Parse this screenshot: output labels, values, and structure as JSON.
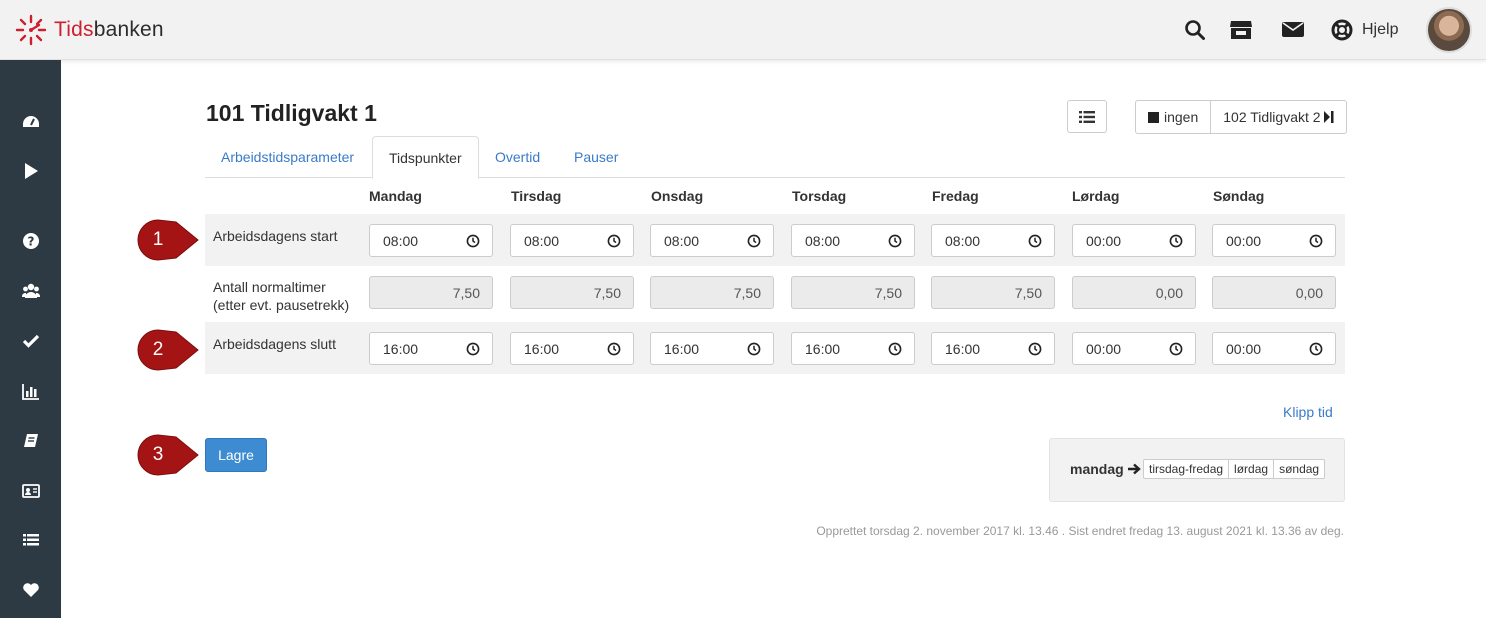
{
  "header": {
    "logo_text_accent": "Tids",
    "logo_text_rest": "banken",
    "help_label": "Hjelp",
    "icons": [
      "search-icon",
      "store-icon",
      "mail-icon",
      "lifebuoy-icon"
    ]
  },
  "sidebar": {
    "icons": [
      "dashboard-icon",
      "play-icon",
      "question-icon",
      "users-icon",
      "check-icon",
      "bar-chart-icon",
      "book-icon",
      "id-card-icon",
      "list-icon",
      "heart-icon"
    ]
  },
  "page": {
    "title": "101 Tidligvakt 1",
    "nav_prev": "ingen",
    "nav_next": "102 Tidligvakt 2"
  },
  "tabs": [
    {
      "label": "Arbeidstidsparameter",
      "active": false
    },
    {
      "label": "Tidspunkter",
      "active": true
    },
    {
      "label": "Overtid",
      "active": false
    },
    {
      "label": "Pauser",
      "active": false
    }
  ],
  "table": {
    "days": [
      "Mandag",
      "Tirsdag",
      "Onsdag",
      "Torsdag",
      "Fredag",
      "Lørdag",
      "Søndag"
    ],
    "rows": [
      {
        "label": "Arbeidsdagens start",
        "values": [
          "08:00",
          "08:00",
          "08:00",
          "08:00",
          "08:00",
          "00:00",
          "00:00"
        ]
      },
      {
        "label_line1": "Antall normaltimer",
        "label_line2": "(etter evt. pausetrekk)",
        "values": [
          "7,50",
          "7,50",
          "7,50",
          "7,50",
          "7,50",
          "0,00",
          "0,00"
        ]
      },
      {
        "label": "Arbeidsdagens slutt",
        "values": [
          "16:00",
          "16:00",
          "16:00",
          "16:00",
          "16:00",
          "00:00",
          "00:00"
        ]
      }
    ]
  },
  "markers": [
    "1",
    "2",
    "3"
  ],
  "actions": {
    "klipp_tid": "Klipp tid",
    "save": "Lagre",
    "copy_from": "mandag",
    "copy_targets": [
      "tirsdag-fredag",
      "lørdag",
      "søndag"
    ]
  },
  "footer": {
    "note": "Opprettet torsdag 2. november 2017 kl. 13.46 . Sist endret fredag 13. august 2021 kl. 13.36 av deg."
  },
  "colors": {
    "accent_red": "#cc1f2f",
    "marker_red": "#a51414",
    "link_blue": "#3a7bc8",
    "primary_button": "#3d8bd0",
    "sidebar": "#2d3a43"
  }
}
